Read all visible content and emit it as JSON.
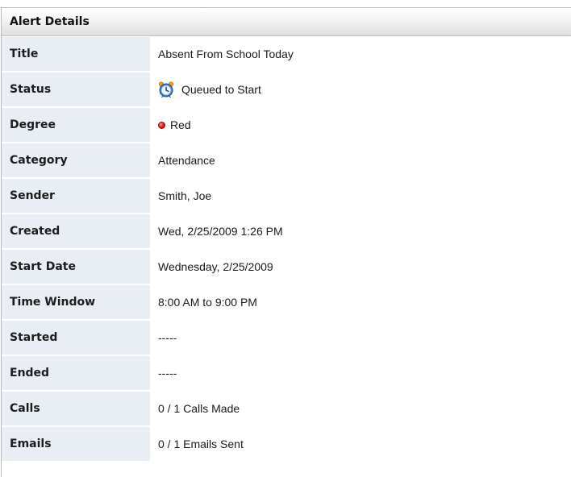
{
  "panel": {
    "title": "Alert Details"
  },
  "rows": [
    {
      "label": "Title",
      "value": "Absent From School Today"
    },
    {
      "label": "Status",
      "value": "Queued to Start",
      "icon": "clock-icon"
    },
    {
      "label": "Degree",
      "value": "Red",
      "icon": "red-dot-icon",
      "color": "#e01818"
    },
    {
      "label": "Category",
      "value": "Attendance"
    },
    {
      "label": "Sender",
      "value": "Smith, Joe"
    },
    {
      "label": "Created",
      "value": "Wed, 2/25/2009 1:26 PM"
    },
    {
      "label": "Start Date",
      "value": "Wednesday, 2/25/2009"
    },
    {
      "label": "Time Window",
      "value": "8:00 AM to 9:00 PM"
    },
    {
      "label": "Started",
      "value": "-----"
    },
    {
      "label": "Ended",
      "value": "-----"
    },
    {
      "label": "Calls",
      "value": "0 / 1 Calls Made"
    },
    {
      "label": "Emails",
      "value": "0 / 1 Emails Sent"
    }
  ],
  "colors": {
    "label_background": "#e9edf4",
    "header_gradient_bottom": "#dedede",
    "border": "#b8b8b8"
  }
}
